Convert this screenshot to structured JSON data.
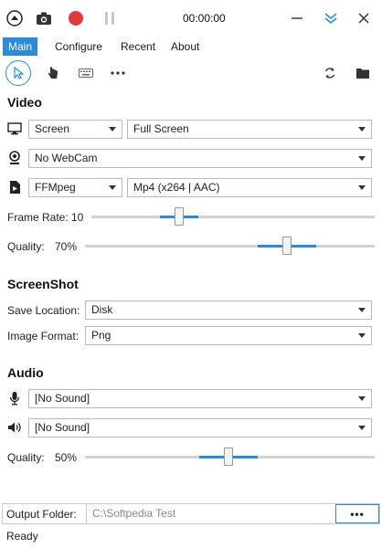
{
  "toolbar": {
    "timer": "00:00:00"
  },
  "tabs": [
    {
      "label": "Main",
      "active": true
    },
    {
      "label": "Configure",
      "active": false
    },
    {
      "label": "Recent",
      "active": false
    },
    {
      "label": "About",
      "active": false
    }
  ],
  "video": {
    "heading": "Video",
    "source": "Screen",
    "region": "Full Screen",
    "webcam": "No WebCam",
    "encoder": "FFMpeg",
    "format": "Mp4 (x264 | AAC)",
    "frame_rate_label": "Frame Rate:",
    "frame_rate_value": "10",
    "quality_label": "Quality:",
    "quality_value": "70%"
  },
  "screenshot": {
    "heading": "ScreenShot",
    "save_location_label": "Save Location:",
    "save_location_value": "Disk",
    "image_format_label": "Image Format:",
    "image_format_value": "Png"
  },
  "audio": {
    "heading": "Audio",
    "microphone": "[No Sound]",
    "speaker": "[No Sound]",
    "quality_label": "Quality:",
    "quality_value": "50%"
  },
  "output": {
    "label": "Output Folder:",
    "path": "C:\\Softpedia Test",
    "browse_label": "•••"
  },
  "status": {
    "text": "Ready"
  },
  "colors": {
    "accent": "#2a8cd8",
    "record": "#e0383e"
  }
}
